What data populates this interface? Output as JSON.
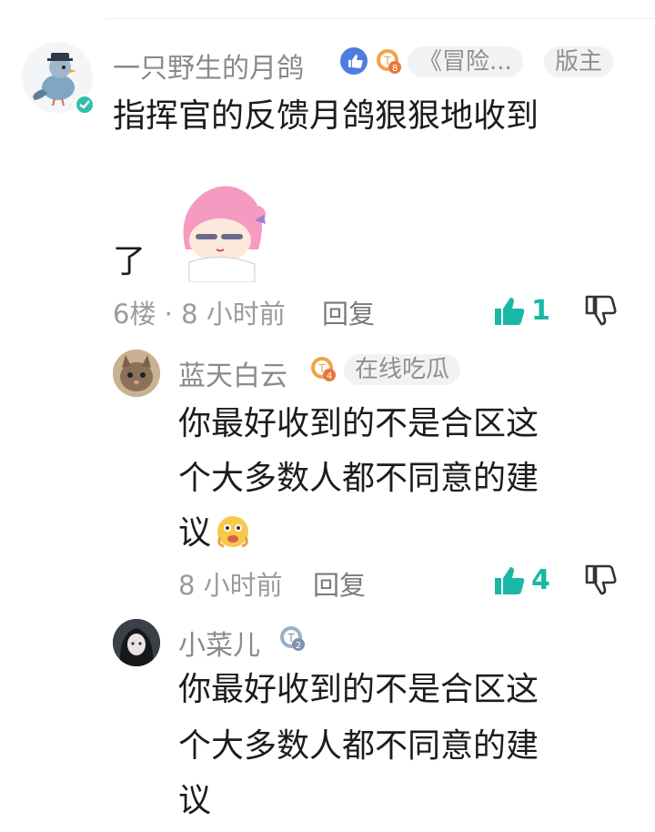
{
  "comments": [
    {
      "username": "一只野生的月鸽",
      "level": "8",
      "tag": "《冒险...",
      "role_tag": "版主",
      "text_line1": "指挥官的反馈月鸽狠狠地收到",
      "text_line2": "了",
      "floor_time": "6楼 · 8 小时前",
      "reply_label": "回复",
      "likes": "1",
      "verified": true
    },
    {
      "username": "蓝天白云",
      "level": "4",
      "tag": "在线吃瓜",
      "text_line1": "你最好收到的不是合区这",
      "text_line2": "个大多数人都不同意的建",
      "text_line3": "议",
      "time": "8 小时前",
      "reply_label": "回复",
      "likes": "4"
    },
    {
      "username": "小菜儿",
      "level": "2",
      "text_line1": "你最好收到的不是合区这",
      "text_line2": "个大多数人都不同意的建",
      "text_line3": "议"
    }
  ],
  "colors": {
    "accent": "#18b8a6",
    "meta": "#9b9b9b",
    "tag_bg": "#f1f2f4"
  },
  "icons": [
    "thumbs-up-icon",
    "thumbs-down-icon",
    "level-badge-icon",
    "verified-icon",
    "emoji-icon"
  ]
}
